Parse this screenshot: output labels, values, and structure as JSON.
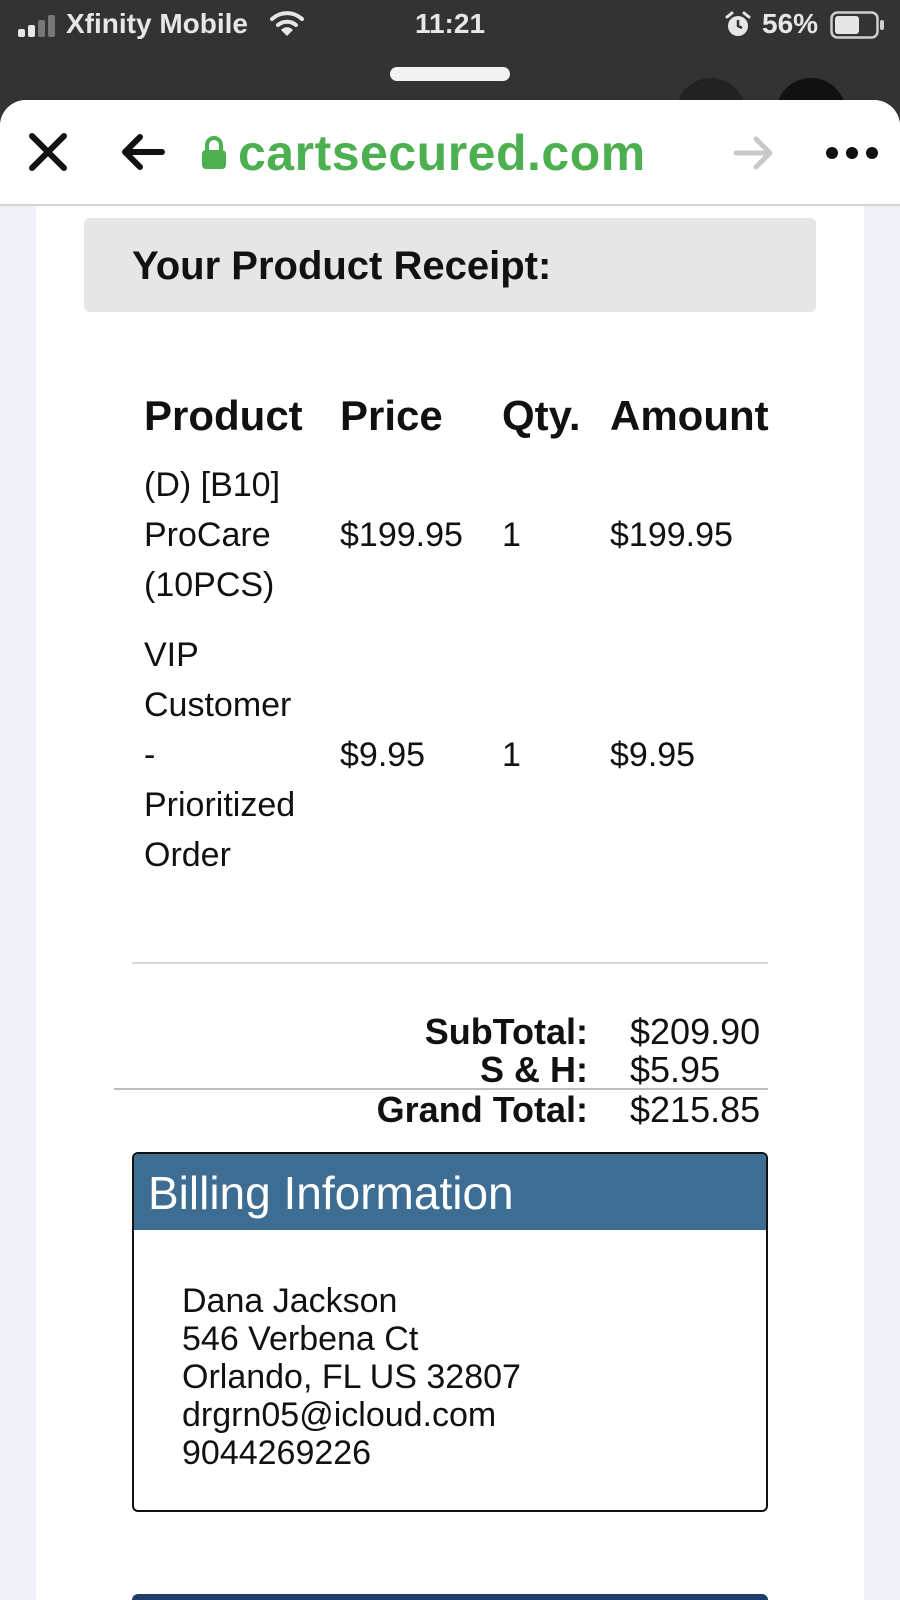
{
  "status_bar": {
    "carrier": "Xfinity Mobile",
    "time": "11:21",
    "battery": "56%",
    "signal_bars": 2
  },
  "browser": {
    "url": "cartsecured.com",
    "icons": {
      "close": "close-icon",
      "back": "arrow-left-icon",
      "lock": "lock-icon",
      "forward": "arrow-right-icon",
      "more": "more-icon"
    },
    "colors": {
      "url": "#4caf50",
      "forward_disabled": "#c8c8c8"
    }
  },
  "receipt": {
    "title": "Your Product Receipt:",
    "columns": [
      "Product",
      "Price",
      "Qty.",
      "Amount"
    ],
    "rows": [
      {
        "product_lines": [
          "(D) [B10]",
          "ProCare",
          "(10PCS)"
        ],
        "price": "$199.95",
        "qty": "1",
        "amount": "$199.95"
      },
      {
        "product_lines": [
          "VIP",
          "Customer",
          "-",
          "Prioritized",
          "Order"
        ],
        "price": "$9.95",
        "qty": "1",
        "amount": "$9.95"
      }
    ],
    "totals": {
      "subtotal_label": "SubTotal:",
      "subtotal_value": "$209.90",
      "sh_label": "S & H:",
      "sh_value": "$5.95",
      "grand_label": "Grand Total:",
      "grand_value": "$215.85"
    }
  },
  "billing": {
    "title": "Billing Information",
    "name": "Dana Jackson",
    "street": "546 Verbena Ct",
    "city_line": "Orlando, FL US 32807",
    "email": "drgrn05@icloud.com",
    "phone": "9044269226",
    "header_color": "#3d6d93"
  }
}
